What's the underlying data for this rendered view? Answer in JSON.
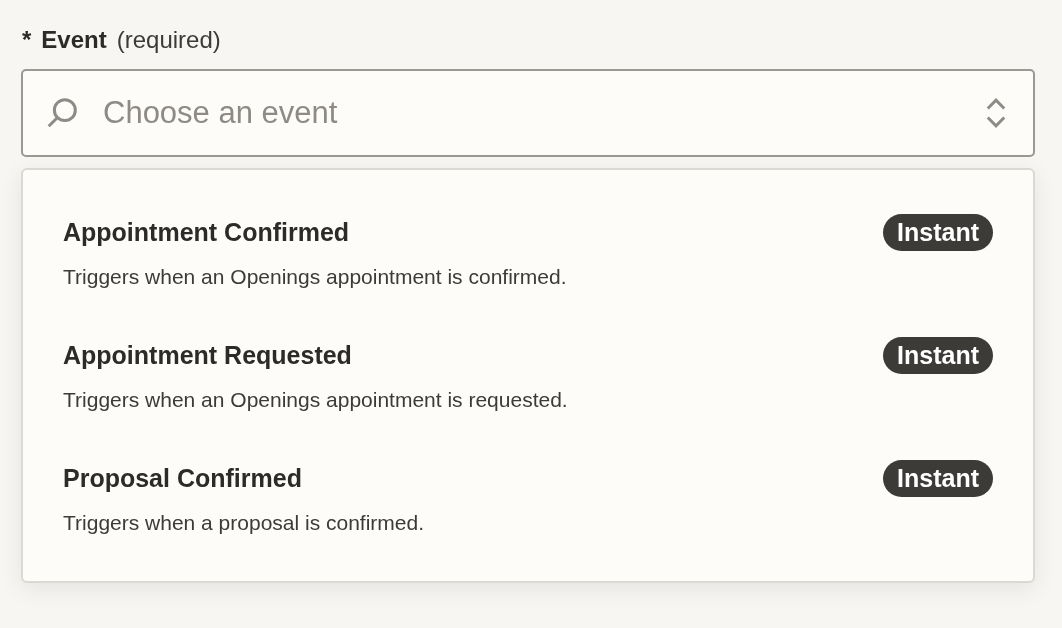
{
  "field": {
    "required_mark": "*",
    "label": "Event",
    "hint": "(required)",
    "placeholder": "Choose an event"
  },
  "options": [
    {
      "title": "Appointment Confirmed",
      "badge": "Instant",
      "description": "Triggers when an Openings appointment is confirmed."
    },
    {
      "title": "Appointment Requested",
      "badge": "Instant",
      "description": "Triggers when an Openings appointment is requested."
    },
    {
      "title": "Proposal Confirmed",
      "badge": "Instant",
      "description": "Triggers when a proposal is confirmed."
    }
  ]
}
